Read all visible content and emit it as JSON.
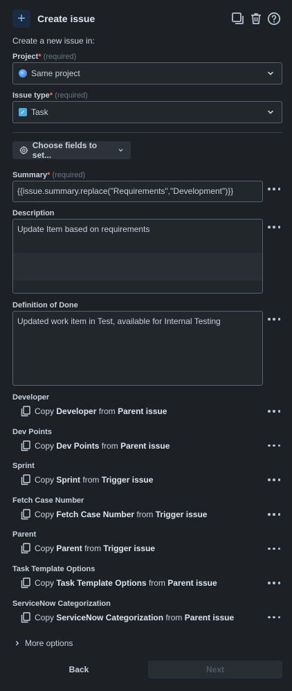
{
  "header": {
    "title": "Create issue",
    "icons": [
      "plus-icon",
      "duplicate-icon",
      "trash-icon",
      "help-icon"
    ]
  },
  "intro": "Create a new issue in:",
  "project": {
    "label": "Project",
    "required_mark": "*",
    "hint": "(required)",
    "value": "Same project"
  },
  "issue_type": {
    "label": "Issue type",
    "required_mark": "*",
    "hint": "(required)",
    "value": "Task"
  },
  "choose_fields": {
    "label": "Choose fields to set..."
  },
  "summary": {
    "label": "Summary",
    "required_mark": "*",
    "hint": "(required)",
    "value": "{{issue.summary.replace(\"Requirements\",\"Development\")}}"
  },
  "description": {
    "label": "Description",
    "value": "Update Item based on requirements"
  },
  "definition_of_done": {
    "label": "Definition of Done",
    "value": "Updated work item in Test, available for Internal Testing"
  },
  "copy_fields": [
    {
      "label": "Developer",
      "prefix": "Copy",
      "field": "Developer",
      "from": "from",
      "source": "Parent issue"
    },
    {
      "label": "Dev Points",
      "prefix": "Copy",
      "field": "Dev Points",
      "from": "from",
      "source": "Parent issue"
    },
    {
      "label": "Sprint",
      "prefix": "Copy",
      "field": "Sprint",
      "from": "from",
      "source": "Trigger issue"
    },
    {
      "label": "Fetch Case Number",
      "prefix": "Copy",
      "field": "Fetch Case Number",
      "from": "from",
      "source": "Trigger issue"
    },
    {
      "label": "Parent",
      "prefix": "Copy",
      "field": "Parent",
      "from": "from",
      "source": "Trigger issue"
    },
    {
      "label": "Task Template Options",
      "prefix": "Copy",
      "field": "Task Template Options",
      "from": "from",
      "source": "Parent issue"
    },
    {
      "label": "ServiceNow Categorization",
      "prefix": "Copy",
      "field": "ServiceNow Categorization",
      "from": "from",
      "source": "Parent issue"
    }
  ],
  "more_options": "More options",
  "footer": {
    "back": "Back",
    "next": "Next"
  },
  "colors": {
    "background": "#1d2125",
    "accent": "#85b8ff",
    "required": "#f87168"
  }
}
